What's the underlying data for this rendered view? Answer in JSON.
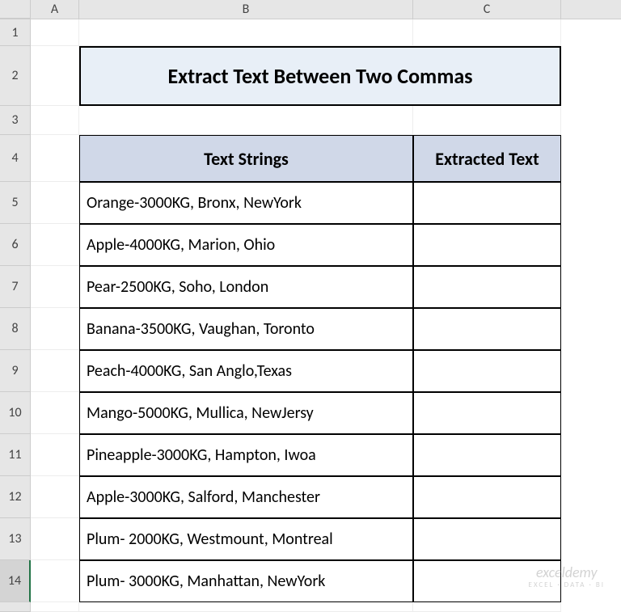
{
  "columns": {
    "A": "A",
    "B": "B",
    "C": "C"
  },
  "rows": [
    "1",
    "2",
    "3",
    "4",
    "5",
    "6",
    "7",
    "8",
    "9",
    "10",
    "11",
    "12",
    "13",
    "14"
  ],
  "title": "Extract Text Between Two Commas",
  "table": {
    "headers": {
      "col1": "Text Strings",
      "col2": "Extracted Text"
    },
    "data": [
      {
        "text": "Orange-3000KG, Bronx, NewYork",
        "extracted": ""
      },
      {
        "text": "Apple-4000KG, Marion, Ohio",
        "extracted": ""
      },
      {
        "text": "Pear-2500KG, Soho, London",
        "extracted": ""
      },
      {
        "text": "Banana-3500KG, Vaughan, Toronto",
        "extracted": ""
      },
      {
        "text": "Peach-4000KG, San Anglo,Texas",
        "extracted": ""
      },
      {
        "text": "Mango-5000KG, Mullica, NewJersy",
        "extracted": ""
      },
      {
        "text": "Pineapple-3000KG, Hampton, Iwoa",
        "extracted": ""
      },
      {
        "text": "Apple-3000KG, Salford, Manchester",
        "extracted": ""
      },
      {
        "text": "Plum- 2000KG, Westmount, Montreal",
        "extracted": ""
      },
      {
        "text": "Plum- 3000KG, Manhattan, NewYork",
        "extracted": ""
      }
    ]
  },
  "watermark": {
    "main": "exceldemy",
    "sub": "EXCEL · DATA · BI"
  },
  "colors": {
    "titleBg": "#e8eff7",
    "headerBg": "#d0d8e8",
    "gridHeader": "#e6e6e6"
  }
}
